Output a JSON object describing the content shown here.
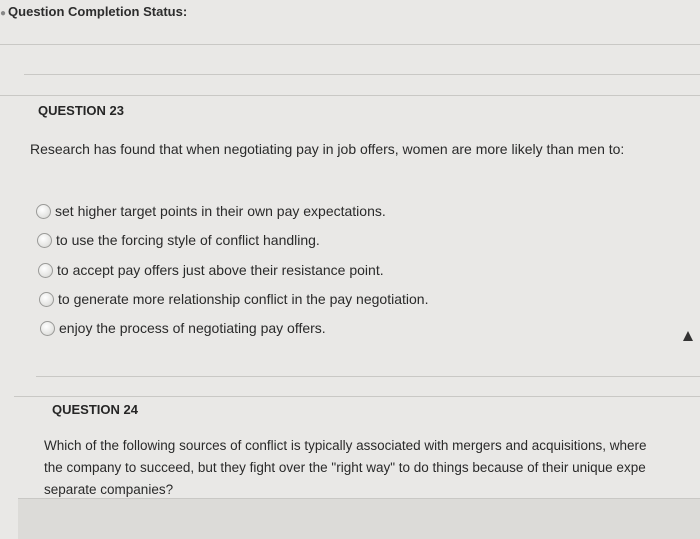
{
  "status": {
    "label": "Question Completion Status:"
  },
  "q23": {
    "heading": "QUESTION 23",
    "prompt": "Research has found that when negotiating pay in job offers, women are more likely than men to:",
    "options": [
      "set higher target points in their own pay expectations.",
      "to use the forcing style of conflict handling.",
      "to accept pay offers just above their resistance point.",
      "to generate more relationship conflict in the pay negotiation.",
      "enjoy the process of negotiating pay offers."
    ]
  },
  "q24": {
    "heading": "QUESTION 24",
    "lines": [
      "Which of the following sources of conflict is typically associated with mergers and acquisitions, where",
      "the company to succeed, but they fight over the \"right way\" to do things because of their unique expe",
      "separate companies?"
    ]
  }
}
